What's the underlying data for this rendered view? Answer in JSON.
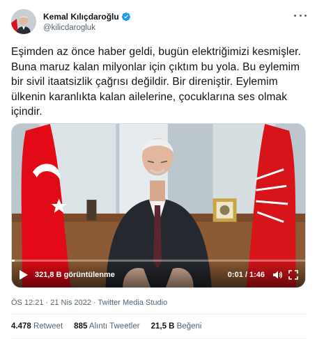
{
  "author": {
    "display_name": "Kemal Kılıçdaroğlu",
    "handle": "@kilicdarogluk",
    "verified_icon": "verified-badge-icon",
    "avatar_icon": "profile-photo"
  },
  "tweet": {
    "text": "Eşimden az önce haber geldi, bugün elektriğimizi kesmişler. Buna maruz kalan milyonlar için çıktım bu yola. Bu eylemim bir sivil itaatsizlik çağrısı değildir. Bir direniştir. Eylemim ülkenin karanlıkta kalan ailelerine, çocuklarına ses olmak içindir."
  },
  "video": {
    "views": "321,8 B görüntülenme",
    "time": "0:01 / 1:46",
    "progress_fraction": 0.01
  },
  "meta": {
    "timestamp": "ÖS 12:21 · 21 Nis 2022 · Twitter Media Studio"
  },
  "stats": {
    "retweets_count": "4.478",
    "retweets_label": "Retweet",
    "quotes_count": "885",
    "quotes_label": "Alıntı Tweetler",
    "likes_count": "21,5 B",
    "likes_label": "Beğeni"
  },
  "colors": {
    "verified": "#1d9bf0",
    "flag_red": "#e30a17",
    "party_red": "#d7141a",
    "meta_gray": "#536471"
  }
}
